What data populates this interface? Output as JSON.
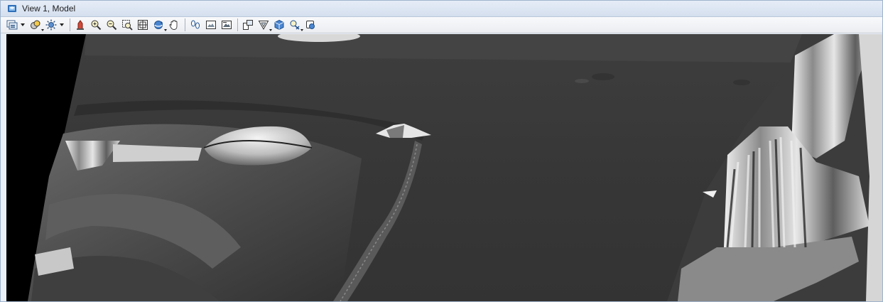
{
  "window": {
    "title": "View 1, Model"
  },
  "toolbar": {
    "buttons": [
      {
        "name": "view-attributes-icon",
        "has_dropdown": true
      },
      {
        "name": "display-style-icon",
        "has_dropdown": true
      },
      {
        "name": "light-icon",
        "has_dropdown": true
      },
      {
        "name": "update-view-icon",
        "has_dropdown": false
      },
      {
        "name": "zoom-in-icon",
        "has_dropdown": false
      },
      {
        "name": "zoom-out-icon",
        "has_dropdown": false
      },
      {
        "name": "window-area-icon",
        "has_dropdown": false
      },
      {
        "name": "fit-view-icon",
        "has_dropdown": false
      },
      {
        "name": "rotate-view-icon",
        "has_dropdown": true
      },
      {
        "name": "pan-view-icon",
        "has_dropdown": false
      },
      {
        "name": "walk-icon",
        "has_dropdown": false
      },
      {
        "name": "previous-view-icon",
        "has_dropdown": false
      },
      {
        "name": "next-view-icon",
        "has_dropdown": false
      },
      {
        "name": "view-rotation-icon",
        "has_dropdown": false
      },
      {
        "name": "clip-volume-icon",
        "has_dropdown": true
      },
      {
        "name": "standard-view-icon",
        "has_dropdown": false
      },
      {
        "name": "camera-icon",
        "has_dropdown": true
      },
      {
        "name": "render-icon",
        "has_dropdown": false
      }
    ]
  },
  "colors": {
    "titlebar": "#dbe5f1",
    "toolbar": "#eef0f3",
    "viewport_background": "#000000",
    "terrain": "#3a3a3a",
    "highlight": "#e8e8e8"
  }
}
